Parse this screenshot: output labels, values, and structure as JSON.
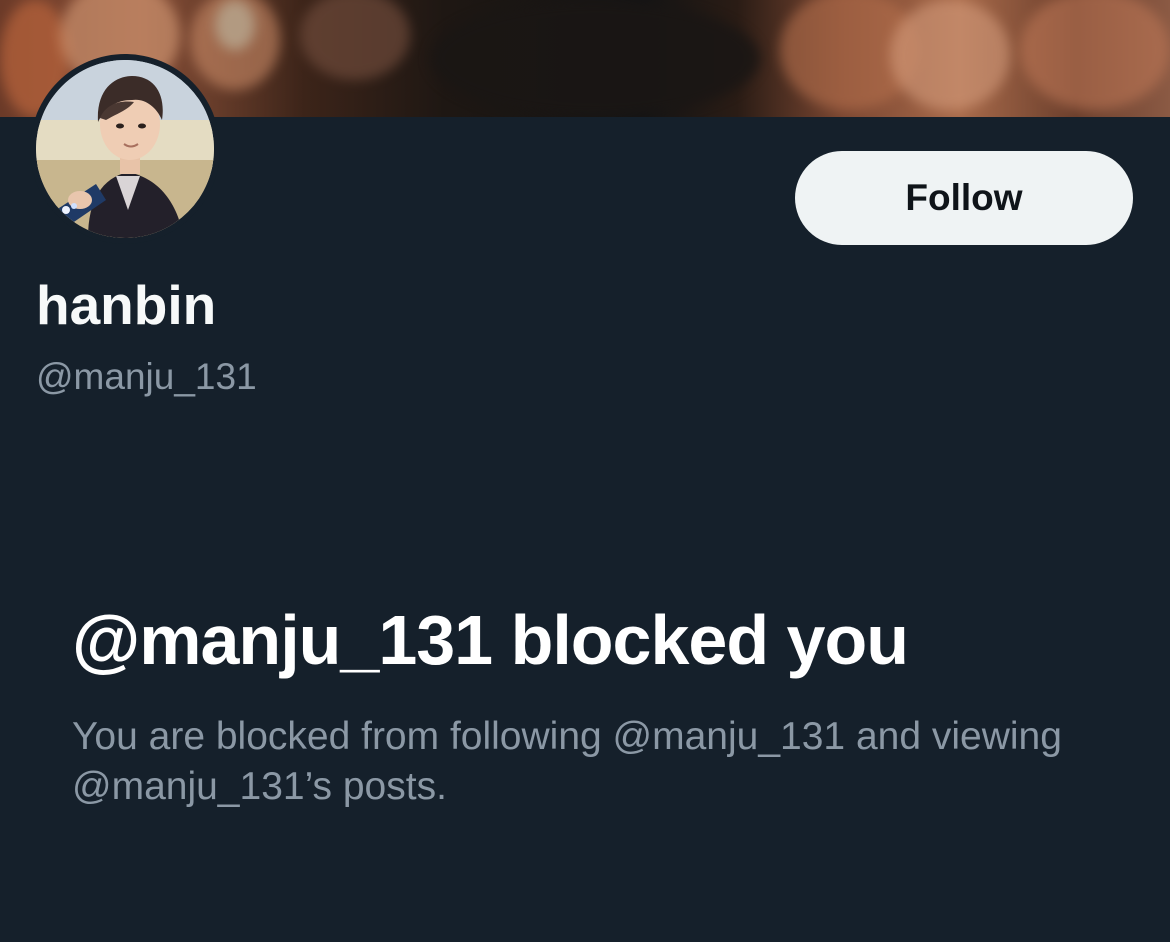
{
  "banner": {
    "image": "concert-crowd-photo"
  },
  "avatar": {
    "image": "profile-photo"
  },
  "profile": {
    "display_name": "hanbin",
    "handle": "@manju_131"
  },
  "actions": {
    "follow_label": "Follow"
  },
  "blocked": {
    "title": "@manju_131 blocked you",
    "description": "You are blocked from following @manju_131 and viewing @manju_131’s posts."
  },
  "colors": {
    "background": "#15202b",
    "primary_text": "#f7f9f9",
    "secondary_text": "#8b98a5",
    "button_bg": "#eff3f4",
    "button_text": "#0f1419"
  }
}
